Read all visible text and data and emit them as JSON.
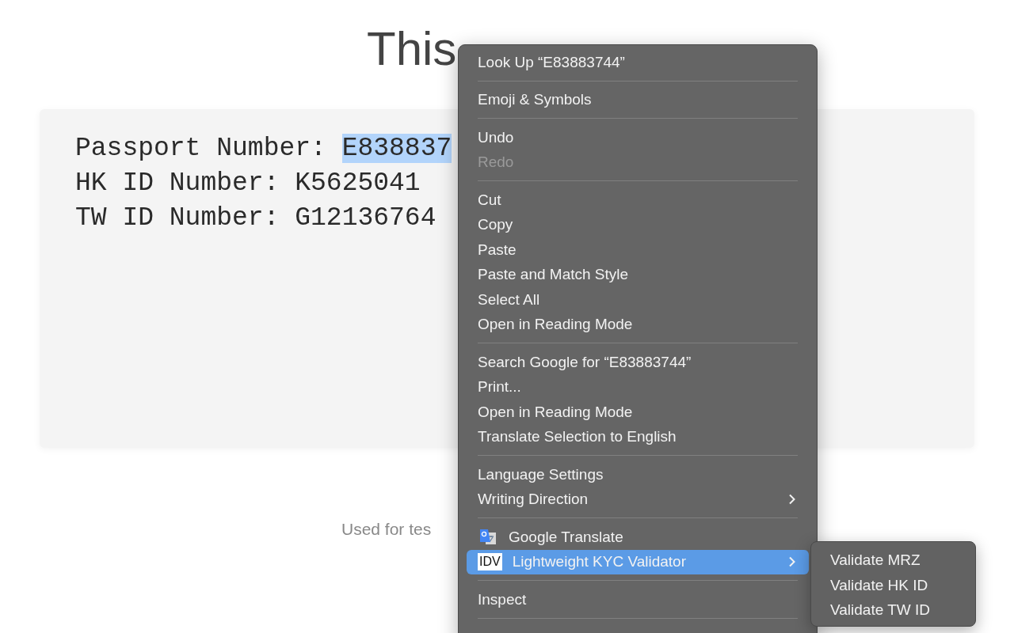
{
  "page": {
    "title": "This",
    "box_lines": [
      {
        "label": "Passport Number: ",
        "value": "E838837",
        "selected": true
      },
      {
        "label": "HK ID Number: ",
        "value": "K5625041",
        "selected": false
      },
      {
        "label": "TW ID Number: ",
        "value": "G12136764",
        "selected": false
      }
    ],
    "caption": "Used for tes"
  },
  "context_menu": {
    "items": [
      {
        "kind": "item",
        "label": "Look Up “E83883744”",
        "disabled": false,
        "selected": false
      },
      {
        "kind": "separator"
      },
      {
        "kind": "item",
        "label": "Emoji & Symbols",
        "disabled": false,
        "selected": false
      },
      {
        "kind": "separator"
      },
      {
        "kind": "item",
        "label": "Undo",
        "disabled": false,
        "selected": false
      },
      {
        "kind": "item",
        "label": "Redo",
        "disabled": true,
        "selected": false
      },
      {
        "kind": "separator"
      },
      {
        "kind": "item",
        "label": "Cut",
        "disabled": false,
        "selected": false
      },
      {
        "kind": "item",
        "label": "Copy",
        "disabled": false,
        "selected": false
      },
      {
        "kind": "item",
        "label": "Paste",
        "disabled": false,
        "selected": false
      },
      {
        "kind": "item",
        "label": "Paste and Match Style",
        "disabled": false,
        "selected": false
      },
      {
        "kind": "item",
        "label": "Select All",
        "disabled": false,
        "selected": false
      },
      {
        "kind": "item",
        "label": "Open in Reading Mode",
        "disabled": false,
        "selected": false
      },
      {
        "kind": "separator"
      },
      {
        "kind": "item",
        "label": "Search Google for “E83883744”",
        "disabled": false,
        "selected": false
      },
      {
        "kind": "item",
        "label": "Print...",
        "disabled": false,
        "selected": false
      },
      {
        "kind": "item",
        "label": "Open in Reading Mode",
        "disabled": false,
        "selected": false
      },
      {
        "kind": "item",
        "label": "Translate Selection to English",
        "disabled": false,
        "selected": false
      },
      {
        "kind": "separator"
      },
      {
        "kind": "item",
        "label": "Language Settings",
        "disabled": false,
        "selected": false
      },
      {
        "kind": "submenu",
        "label": "Writing Direction",
        "disabled": false,
        "selected": false
      },
      {
        "kind": "separator"
      },
      {
        "kind": "translate",
        "label": "Google Translate",
        "disabled": false,
        "selected": false
      },
      {
        "kind": "badge",
        "icon_text": "IDV",
        "label": "Lightweight KYC Validator",
        "submenu": true,
        "disabled": false,
        "selected": true
      },
      {
        "kind": "separator"
      },
      {
        "kind": "item",
        "label": "Inspect",
        "disabled": false,
        "selected": false
      },
      {
        "kind": "separator"
      }
    ]
  },
  "submenu": {
    "items": [
      {
        "label": "Validate MRZ"
      },
      {
        "label": "Validate HK ID"
      },
      {
        "label": "Validate TW ID"
      }
    ]
  }
}
